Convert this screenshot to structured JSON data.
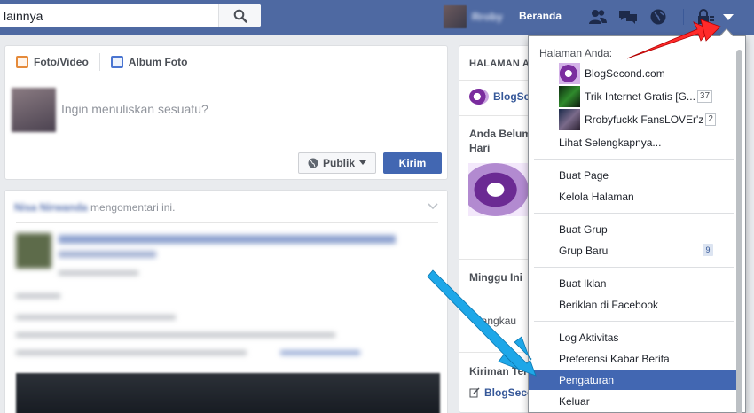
{
  "search": {
    "value": "lainnya"
  },
  "topbar": {
    "profile_name": "Rroby",
    "home_label": "Beranda",
    "icons": [
      "friends-icon",
      "messages-icon",
      "globe-notifications-icon",
      "privacy-lock-icon",
      "account-menu-caret-icon"
    ]
  },
  "composer": {
    "tabs": [
      {
        "label": "Foto/Video",
        "icon": "photo-icon"
      },
      {
        "label": "Album Foto",
        "icon": "album-icon"
      }
    ],
    "placeholder": "Ingin menuliskan sesuatu?",
    "audience_label": "Publik",
    "post_label": "Kirim"
  },
  "story": {
    "actor": "Nisa Nirwanda",
    "action": "mengomentari ini."
  },
  "right_column": {
    "header": "HALAMAN A",
    "page_name": "BlogSe",
    "text_1a": "Anda Belum",
    "text_1b": "Hari",
    "text_2": "Minggu Ini",
    "text_3": "langkau",
    "text_4": "Kiriman Ter",
    "link_1": "BlogSeco"
  },
  "dropdown": {
    "section_title": "Halaman Anda:",
    "pages": [
      {
        "name": "BlogSecond.com",
        "badge": ""
      },
      {
        "name": "Trik Internet Gratis [G...",
        "badge": "37"
      },
      {
        "name": "Rrobyfuckk FansLOVEr'z",
        "badge": "2"
      }
    ],
    "see_more": "Lihat Selengkapnya...",
    "items": {
      "create_page": "Buat Page",
      "manage_pages": "Kelola Halaman",
      "create_group": "Buat Grup",
      "new_groups": "Grup Baru",
      "new_groups_count": "9",
      "create_ad": "Buat Iklan",
      "advertise": "Beriklan di Facebook",
      "activity_log": "Log Aktivitas",
      "news_feed_prefs": "Preferensi Kabar Berita",
      "settings": "Pengaturan",
      "logout": "Keluar"
    }
  },
  "colors": {
    "topbar": "#4e69a2",
    "highlight": "#4267b2",
    "red_arrow": "#ff2a2a",
    "blue_arrow": "#1ea7e8"
  }
}
